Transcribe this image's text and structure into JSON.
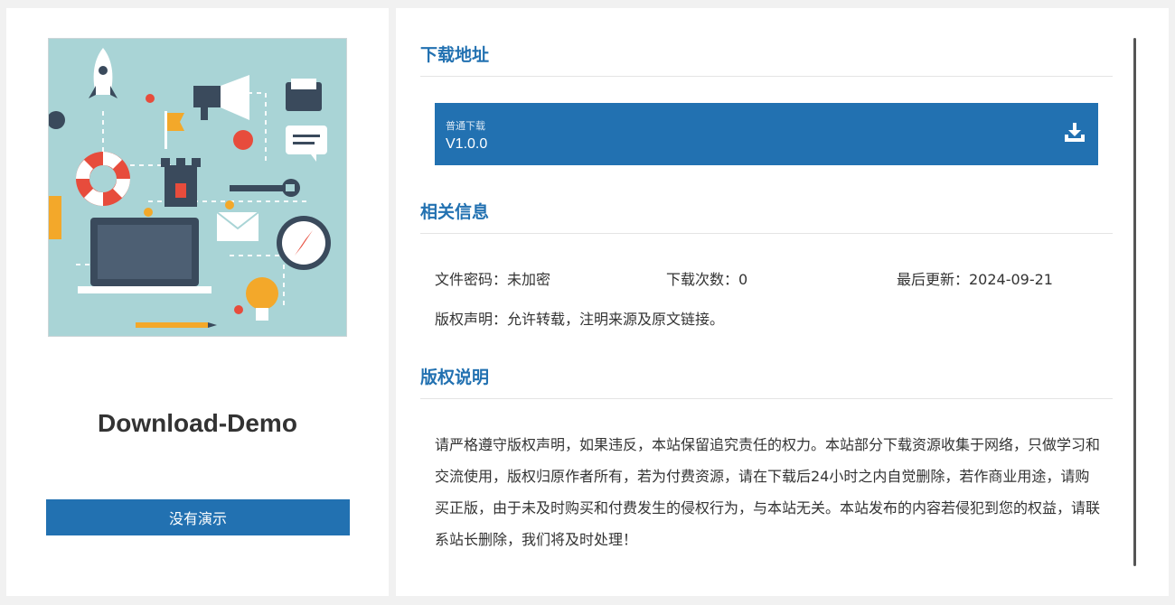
{
  "product": {
    "title": "Download-Demo",
    "demo_button": "没有演示"
  },
  "sections": {
    "download": {
      "title": "下载地址"
    },
    "info": {
      "title": "相关信息"
    },
    "copyright": {
      "title": "版权说明"
    }
  },
  "download_card": {
    "type_label": "普通下载",
    "version": "V1.0.0",
    "icon": "download-tray-icon"
  },
  "info": {
    "password": "文件密码：未加密",
    "download_count": "下载次数：0",
    "last_update": "最后更新：2024-09-21",
    "copyright_statement": "版权声明：允许转载，注明来源及原文链接。"
  },
  "copyright_text": "请严格遵守版权声明，如果违反，本站保留追究责任的权力。本站部分下载资源收集于网络，只做学习和交流使用，版权归原作者所有，若为付费资源，请在下载后24小时之内自觉删除，若作商业用途，请购买正版，由于未及时购买和付费发生的侵权行为，与本站无关。本站发布的内容若侵犯到您的权益，请联系站长删除，我们将及时处理！",
  "colors": {
    "accent": "#2271b1",
    "background": "#f1f1f1",
    "panel": "#ffffff"
  }
}
